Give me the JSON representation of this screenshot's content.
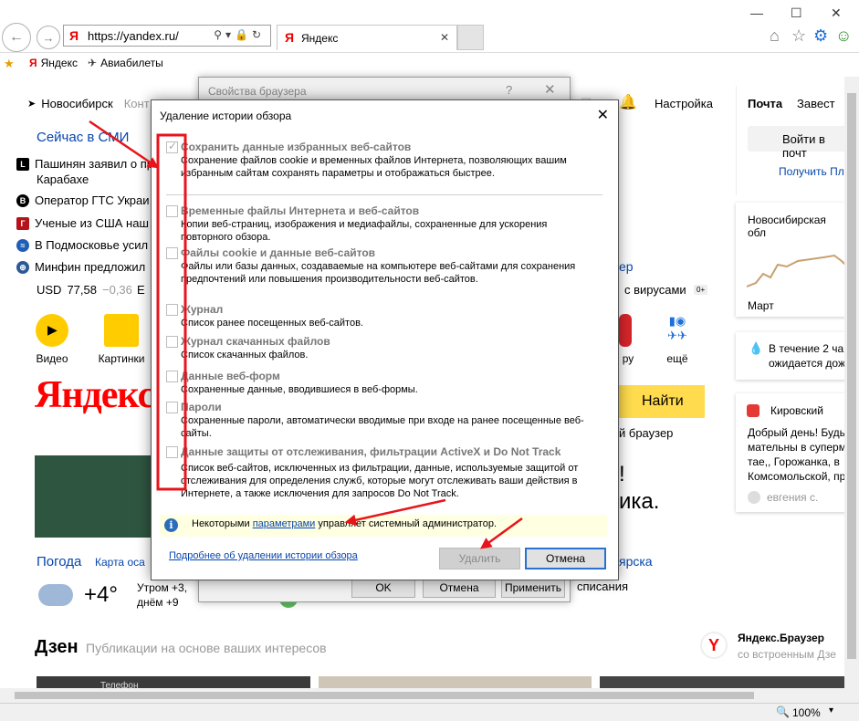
{
  "browser": {
    "url": "https://yandex.ru/",
    "tab_title": "Яндекс",
    "favorites": [
      {
        "label": "Яндекс"
      },
      {
        "label": "Авиабилеты"
      }
    ],
    "zoom": "100%"
  },
  "yandex": {
    "city": "Новосибирск",
    "city_next": "Конт",
    "settings": "Настройка",
    "mail": "Почта",
    "mail_next": "Завест",
    "login_btn": "Войти в почт",
    "get_link": "Получить Пл",
    "news_header": "Сейчас в СМИ",
    "news": [
      {
        "text": "Пашинян заявил о пр",
        "extra": "Карабахе"
      },
      {
        "text": "Оператор ГТС Украи"
      },
      {
        "text": "Ученые из США наш"
      },
      {
        "text": "В Подмосковье усил"
      },
      {
        "text": "Минфин предложил"
      }
    ],
    "usd_label": "USD",
    "usd_value": "77,58",
    "usd_change": "−0,36",
    "usd_extra": "E",
    "right_fragment_1": "ер",
    "right_fragment_2": "с вирусами",
    "right_badge": "0+",
    "services": [
      {
        "label": "Видео"
      },
      {
        "label": "Картинки"
      },
      {
        "label": "ру"
      },
      {
        "label": "ещё"
      }
    ],
    "logo": "Яндекс",
    "find_btn": "Найти",
    "browser_hint": "й браузер",
    "promo_1": "!",
    "promo_2": "ика.",
    "weather_link": "Погода",
    "map_link": "Карта оса",
    "weather_temp": "+4°",
    "weather_morning": "Утром +3,",
    "weather_day": "днём +9",
    "right_link": "ярска",
    "right_text": "списания",
    "zen_title": "Дзен",
    "zen_subtitle": "Публикации на основе ваших интересов",
    "ybrowser_title": "Яндекс.Браузер",
    "ybrowser_sub": "со встроенным Дзе",
    "region": "Новосибирская обл",
    "month": "Март",
    "rain_1": "В течение 2 ча",
    "rain_2": "ожидается дож",
    "district": "Кировский",
    "district_text_1": "Добрый день! Будь",
    "district_text_2": "мательны в суперм",
    "district_text_3": "тае,, Горожанка, в",
    "district_text_4": "Комсомольской, пр",
    "district_author": "евгения с.",
    "zen_card_1": "Телефон"
  },
  "props_dialog": {
    "title": "Свойства браузера",
    "help": "?",
    "ok": "OK",
    "cancel": "Отмена",
    "apply": "Применить"
  },
  "dialog": {
    "title": "Удаление истории обзора",
    "options": [
      {
        "label": "Сохранить данные избранных веб-сайтов",
        "desc": "Сохранение файлов cookie и временных файлов Интернета, позволяющих вашим избранным сайтам сохранять параметры и отображаться быстрее.",
        "checked": true
      },
      {
        "label": "Временные файлы Интернета и веб-сайтов",
        "desc": "Копии веб-страниц, изображения и медиафайлы, сохраненные для ускорения повторного обзора.",
        "checked": false
      },
      {
        "label": "Файлы cookie и данные веб-сайтов",
        "desc": "Файлы или базы данных, создаваемые на компьютере веб-сайтами для сохранения предпочтений или повышения производительности веб-сайтов.",
        "checked": false
      },
      {
        "label": "Журнал",
        "desc": "Список ранее посещенных веб-сайтов.",
        "checked": false
      },
      {
        "label": "Журнал скачанных файлов",
        "desc": "Список скачанных файлов.",
        "checked": false
      },
      {
        "label": "Данные веб-форм",
        "desc": "Сохраненные данные, вводившиеся в веб-формы.",
        "checked": false
      },
      {
        "label": "Пароли",
        "desc": "Сохраненные пароли, автоматически вводимые при входе на ранее посещенные веб-сайты.",
        "checked": false
      },
      {
        "label": "Данные защиты от отслеживания, фильтрации ActiveX и Do Not Track",
        "desc": "Список веб-сайтов, исключенных из фильтрации, данные, используемые защитой от отслеживания для определения служб, которые могут отслеживать ваши действия в Интернете, а также исключения для запросов Do Not Track.",
        "checked": false
      }
    ],
    "info_prefix": "Некоторыми",
    "info_link": "параметрами",
    "info_suffix": "управляет системный администратор.",
    "more_link": "Подробнее об удалении истории обзора",
    "delete_btn": "Удалить",
    "cancel_btn": "Отмена"
  },
  "colors": {
    "annotation": "#e8141b",
    "yandex_red": "#f00",
    "find_yellow": "#ffdb4d"
  }
}
